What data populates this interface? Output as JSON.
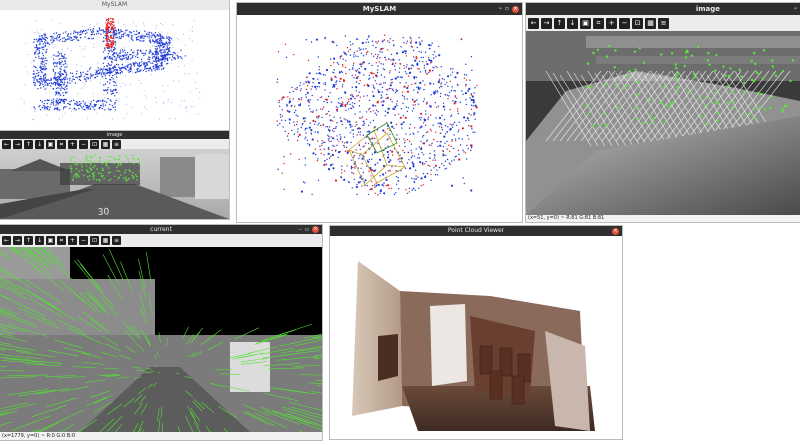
{
  "windows": {
    "top_left": {
      "title": "MySLAM"
    },
    "top_left_sub": {
      "title": "image"
    },
    "top_middle": {
      "title": "MySLAM"
    },
    "top_right": {
      "title": "image",
      "status": "(x=51, y=0) ~ R:81 G:81 B:81"
    },
    "bottom_left": {
      "title": "current",
      "status": "(x=1779, y=0) ~ R:0 G:0 B:0"
    },
    "bottom_middle": {
      "title": "Point Cloud Viewer"
    }
  },
  "road_text": "30",
  "toolbar_icons": [
    "arrow-left-icon",
    "arrow-right-icon",
    "arrow-up-icon",
    "arrow-down-icon",
    "save-icon",
    "crop-icon",
    "zoom-in-icon",
    "zoom-out-icon",
    "zoom-fit-icon",
    "image-icon",
    "properties-icon"
  ],
  "colors": {
    "map_blue": "#1f3bd6",
    "map_red": "#e3211c",
    "keypoint_green": "#58e83a",
    "close_red": "#e2533b"
  }
}
